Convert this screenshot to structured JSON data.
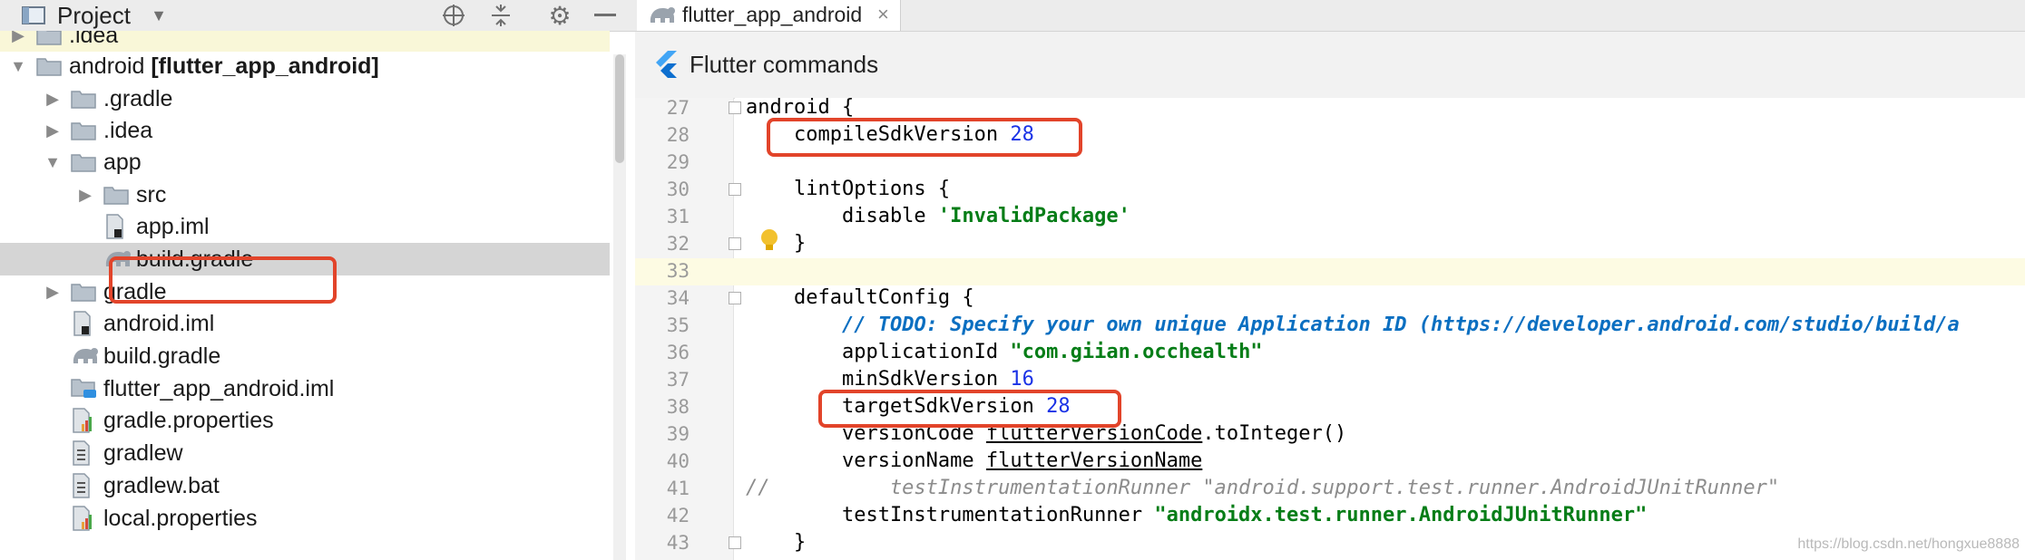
{
  "project_panel": {
    "title": "Project",
    "tree": [
      {
        "label": ".idea",
        "indent": 1,
        "arrow": "right",
        "icon": "folder-icon"
      },
      {
        "label": "android ",
        "bold": "[flutter_app_android]",
        "indent": 1,
        "arrow": "down",
        "icon": "module-folder-icon"
      },
      {
        "label": ".gradle",
        "indent": 2,
        "arrow": "right",
        "icon": "folder-icon"
      },
      {
        "label": ".idea",
        "indent": 2,
        "arrow": "right",
        "icon": "folder-icon"
      },
      {
        "label": "app",
        "indent": 2,
        "arrow": "down",
        "icon": "folder-icon"
      },
      {
        "label": "src",
        "indent": 3,
        "arrow": "right",
        "icon": "folder-icon"
      },
      {
        "label": "app.iml",
        "indent": 3,
        "arrow": "",
        "icon": "iml-file-icon"
      },
      {
        "label": "build.gradle",
        "indent": 3,
        "arrow": "",
        "icon": "gradle-elephant-icon",
        "selected": true
      },
      {
        "label": "gradle",
        "indent": 2,
        "arrow": "right",
        "icon": "folder-icon"
      },
      {
        "label": "android.iml",
        "indent": 2,
        "arrow": "",
        "icon": "iml-file-icon"
      },
      {
        "label": "build.gradle",
        "indent": 2,
        "arrow": "",
        "icon": "gradle-elephant-icon"
      },
      {
        "label": "flutter_app_android.iml",
        "indent": 2,
        "arrow": "",
        "icon": "module-iml-icon"
      },
      {
        "label": "gradle.properties",
        "indent": 2,
        "arrow": "",
        "icon": "properties-file-icon"
      },
      {
        "label": "gradlew",
        "indent": 2,
        "arrow": "",
        "icon": "text-file-icon"
      },
      {
        "label": "gradlew.bat",
        "indent": 2,
        "arrow": "",
        "icon": "text-file-icon"
      },
      {
        "label": "local.properties",
        "indent": 2,
        "arrow": "",
        "icon": "properties-file-icon"
      }
    ]
  },
  "editor": {
    "tab_label": "flutter_app_android",
    "tab_close": "×",
    "flutter_bar_label": "Flutter commands",
    "lines": [
      {
        "n": "27",
        "code": "android {"
      },
      {
        "n": "28",
        "code": "    compileSdkVersion 28"
      },
      {
        "n": "29",
        "code": ""
      },
      {
        "n": "30",
        "code": "    lintOptions {"
      },
      {
        "n": "31",
        "code": "        disable 'InvalidPackage'"
      },
      {
        "n": "32",
        "code": "    }"
      },
      {
        "n": "33",
        "code": ""
      },
      {
        "n": "34",
        "code": "    defaultConfig {"
      },
      {
        "n": "35",
        "code": "        // TODO: Specify your own unique Application ID (https://developer.android.com/studio/build/a"
      },
      {
        "n": "36",
        "code": "        applicationId \"com.giian.occhealth\""
      },
      {
        "n": "37",
        "code": "        minSdkVersion 16"
      },
      {
        "n": "38",
        "code": "        targetSdkVersion 28"
      },
      {
        "n": "39",
        "code": "        versionCode flutterVersionCode.toInteger()"
      },
      {
        "n": "40",
        "code": "        versionName flutterVersionName"
      },
      {
        "n": "41",
        "code": "//          testInstrumentationRunner \"android.support.test.runner.AndroidJUnitRunner\""
      },
      {
        "n": "42",
        "code": "        testInstrumentationRunner \"androidx.test.runner.AndroidJUnitRunner\""
      },
      {
        "n": "43",
        "code": "    }"
      }
    ]
  },
  "watermark": "https://blog.csdn.net/hongxue8888",
  "colors": {
    "highlight_box": "#e2442a",
    "number": "#1a32e6",
    "string": "#067d17",
    "todo": "#0b6fc1"
  }
}
